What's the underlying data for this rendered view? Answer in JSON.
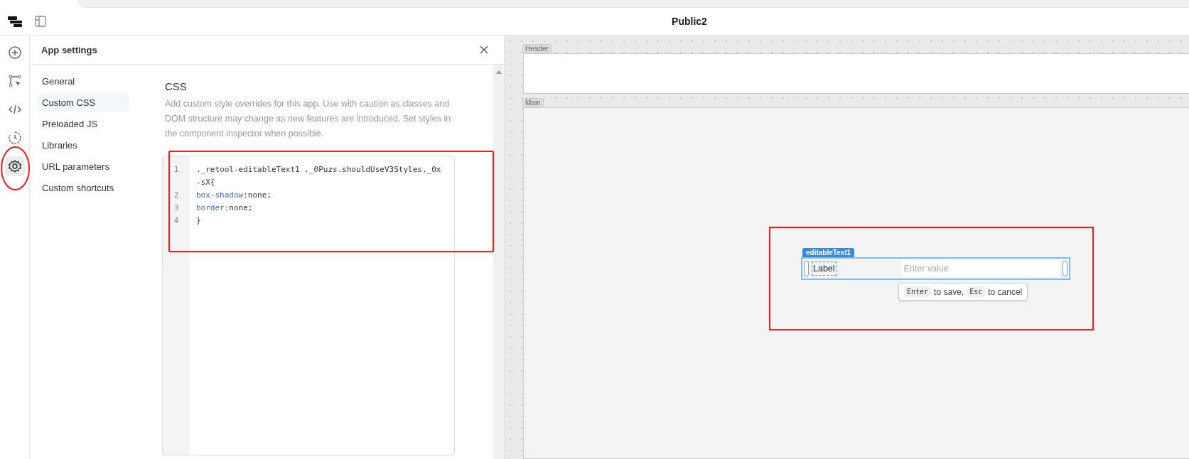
{
  "window": {
    "title": "Public2"
  },
  "rail": [
    {
      "kind": "plus",
      "selected": false
    },
    {
      "kind": "flow",
      "selected": false
    },
    {
      "kind": "code",
      "selected": false
    },
    {
      "kind": "history",
      "selected": false
    },
    {
      "kind": "gear",
      "selected": true
    }
  ],
  "settings": {
    "title": "App settings",
    "nav": [
      {
        "label": "General",
        "selected": false
      },
      {
        "label": "Custom CSS",
        "selected": true
      },
      {
        "label": "Preloaded JS",
        "selected": false
      },
      {
        "label": "Libraries",
        "selected": false
      },
      {
        "label": "URL parameters",
        "selected": false
      },
      {
        "label": "Custom shortcuts",
        "selected": false
      }
    ],
    "heading": "CSS",
    "description": "Add custom style overrides for this app. Use with caution as classes and DOM structure may change as new features are introduced. Set styles in the component inspector when possible.",
    "code": [
      {
        "number": "1",
        "tokens": [
          {
            "text": "._retool-editableText1 ._0Puzs.shouldUseV3Styles._0x-sX{",
            "kind": "plain"
          }
        ]
      },
      {
        "number": "2",
        "tokens": [
          {
            "text": " box-shadow",
            "kind": "property"
          },
          {
            "text": ":none;",
            "kind": "plain"
          }
        ]
      },
      {
        "number": "3",
        "tokens": [
          {
            "text": " border",
            "kind": "property"
          },
          {
            "text": ":none;",
            "kind": "plain"
          }
        ]
      },
      {
        "number": "4",
        "tokens": [
          {
            "text": "}",
            "kind": "plain"
          }
        ]
      }
    ]
  },
  "canvas": {
    "sections": [
      {
        "label": "Header"
      },
      {
        "label": "Main"
      }
    ],
    "component": {
      "name": "editableText1",
      "label": "Label",
      "placeholder": "Enter value",
      "hint": [
        {
          "text": "Enter",
          "kind": "key"
        },
        {
          "text": "to save,",
          "kind": "text"
        },
        {
          "text": "Esc",
          "kind": "key"
        },
        {
          "text": "to cancel",
          "kind": "text"
        }
      ]
    }
  }
}
